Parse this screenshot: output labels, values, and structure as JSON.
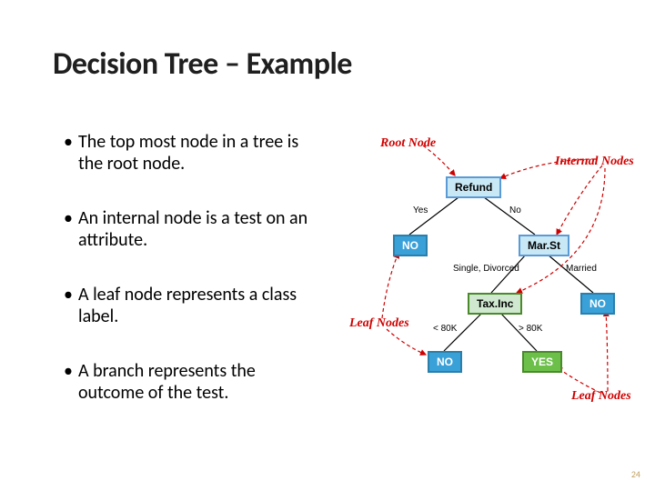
{
  "title": "Decision Tree – Example",
  "bullets": {
    "b1": "The top most node in a tree is the root node.",
    "b2": "An internal node is a test on an attribute.",
    "b3": "A leaf node represents a class label.",
    "b4": "A branch represents the outcome of the test."
  },
  "annotations": {
    "root": "Root Node",
    "internal": "Internal Nodes",
    "leaf_left": "Leaf Nodes",
    "leaf_right": "Leaf Nodes"
  },
  "nodes": {
    "refund": "Refund",
    "marst": "Mar.St",
    "taxinc": "Tax.Inc",
    "no": "NO",
    "yes": "YES"
  },
  "edges": {
    "refund_yes": "Yes",
    "refund_no": "No",
    "marst_single": "Single, Divorced",
    "marst_married": "Married",
    "tax_lt": "< 80K",
    "tax_gt": "> 80K"
  },
  "slide_number": "24"
}
